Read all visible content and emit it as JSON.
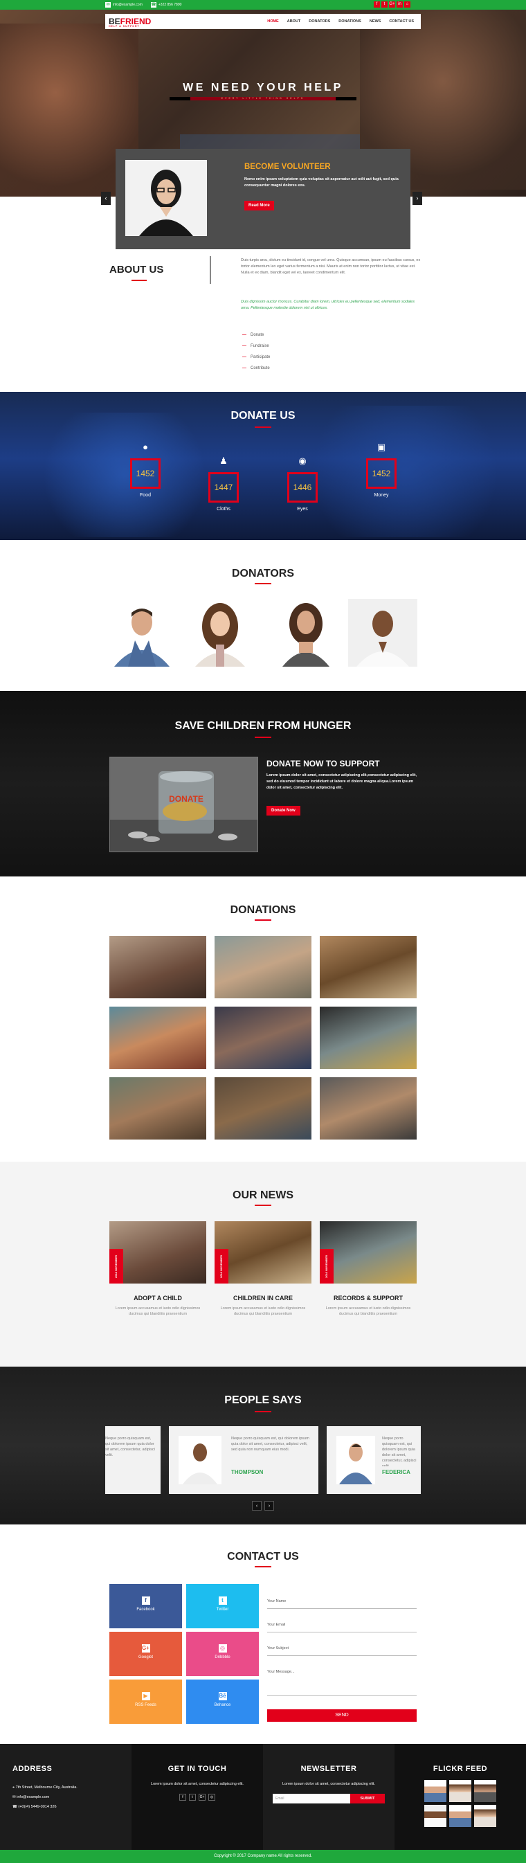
{
  "topbar": {
    "email": "info@example.com",
    "phone": "+322 856 7890",
    "social": [
      "f",
      "t",
      "G+",
      "in",
      "⌂"
    ]
  },
  "nav": {
    "logo_black": "BE",
    "logo_red": "FRIEND",
    "logo_tag": "HELP & SUPPORT",
    "links": [
      "HOME",
      "ABOUT",
      "DONATORS",
      "DONATIONS",
      "NEWS",
      "CONTACT US"
    ]
  },
  "hero": {
    "title": "WE NEED YOUR HELP",
    "subtitle": "EVERY LITTLE THING HELPS",
    "volunteer_title": "BECOME VOLUNTEER",
    "volunteer_text": "Nemo enim ipsam voluptatem quia voluptas sit aspernatur aut odit aut fugit, sed quia consequuntur magni dolores eos.",
    "read_more": "Read More",
    "prev": "‹",
    "next": "›"
  },
  "about": {
    "title": "ABOUT US",
    "text": "Duis turpis arcu, dictum eu tincidunt id, congue vel urna. Quisque accumsan, ipsum eu faucibus cursus, ex tortor elementum leo eget varius fermentum a nisi. Mauris at enim non tortor porttitor luctus, ut vitae est. Nulla et ex diam, blandit eget vel ex, laoreet condimentum elit.",
    "highlight": "Duis dignissim auctor rhoncus. Curabitur diam lorem, ultricies eu pellentesque sed, elementum sodales urna. Pellentesque molestie dolorem nisl ut ultrices.",
    "list": [
      "Donate",
      "Fundraise",
      "Participate",
      "Contribute"
    ]
  },
  "donate_us": {
    "title": "DONATE US",
    "stats": [
      {
        "icon": "apple-icon",
        "glyph": "",
        "value": "1452",
        "label": "Food"
      },
      {
        "icon": "clothes-icon",
        "glyph": "♟",
        "value": "1447",
        "label": "Cloths"
      },
      {
        "icon": "eye-icon",
        "glyph": "◉",
        "value": "1446",
        "label": "Eyes"
      },
      {
        "icon": "money-icon",
        "glyph": "▣",
        "value": "1452",
        "label": "Money"
      }
    ]
  },
  "donators": {
    "title": "DONATORS"
  },
  "hunger": {
    "title": "SAVE CHILDREN FROM HUNGER",
    "subtitle": "DONATE NOW TO SUPPORT",
    "text": "Lorem ipsum dolor sit amet, consectetur adipiscing elit,consectetur adipiscing elit, sed do eiusmod tempor incididunt ut labore et dolore magna aliqua.Lorem ipsum dolor sit amet, consectetur adipiscing elit.",
    "button": "Donate Now",
    "jar_text": "DONATE"
  },
  "donations": {
    "title": "DONATIONS"
  },
  "news": {
    "title": "OUR NEWS",
    "items": [
      {
        "date": "2016 NOVEMBER",
        "title": "ADOPT A CHILD",
        "text": "Lorem ipsum accusamus et iusto odio dignissimos ducimus qui blanditiis praesentium"
      },
      {
        "date": "2016 NOVEMBER",
        "title": "CHILDREN IN CARE",
        "text": "Lorem ipsum accusamus et iusto odio dignissimos ducimus qui blanditiis praesentium"
      },
      {
        "date": "2016 NOVEMBER",
        "title": "RECORDS & SUPPORT",
        "text": "Lorem ipsum accusamus et iusto odio dignissimos ducimus qui blanditiis praesentium"
      }
    ]
  },
  "people": {
    "title": "PEOPLE SAYS",
    "left_text": "Neque porro quisquam est, qui dolorem ipsum quia dolor sit amet, consectetur, adipisci velit.",
    "cards": [
      {
        "name": "THOMPSON",
        "text": "Neque porro quisquam est, qui dolorem ipsum quia dolor sit amet, consectetur, adipisci velit, sed quia non numquam eius modi."
      },
      {
        "name": "FEDERICA",
        "text": "Neque porro quisquam est, qui dolorem ipsum quia dolor sit amet, consectetur, adipisci velit."
      }
    ],
    "prev": "‹",
    "next": "›"
  },
  "contact": {
    "title": "CONTACT US",
    "social": [
      {
        "name": "Facebook",
        "glyph": "f",
        "color": "#3b5998"
      },
      {
        "name": "Twitter",
        "glyph": "t",
        "color": "#1dbdef"
      },
      {
        "name": "Googlet",
        "glyph": "G+",
        "color": "#e65a3c"
      },
      {
        "name": "Dribbble",
        "glyph": "◎",
        "color": "#ea4c89"
      },
      {
        "name": "RSS Feeds",
        "glyph": "▶",
        "color": "#f99c39"
      },
      {
        "name": "Behance",
        "glyph": "Bē",
        "color": "#2f8cf0"
      }
    ],
    "name_placeholder": "Your Name",
    "email_placeholder": "Your Email",
    "subject_placeholder": "Your Subject",
    "message_placeholder": "Your Message...",
    "send": "SEND"
  },
  "footer": {
    "address_title": "ADDRESS",
    "address": "7th Street, Melbourne City, Australia.",
    "email": "info@example.com",
    "phone": "(+0)(4) 5449-0014 326",
    "touch_title": "GET IN TOUCH",
    "touch_text": "Lorem ipsum dolor sit amet, consectetur adipiscing elit.",
    "touch_icons": [
      "f",
      "t",
      "G+",
      "◎"
    ],
    "news_title": "NEWSLETTER",
    "news_text": "Lorem ipsum dolor sit amet, consectetur adipiscing elit.",
    "email_placeholder": "Email",
    "subscribe": "SUBMIT",
    "flickr_title": "FLICKR FEED",
    "copyright": "Copyright © 2017 Company name All rights reserved."
  }
}
